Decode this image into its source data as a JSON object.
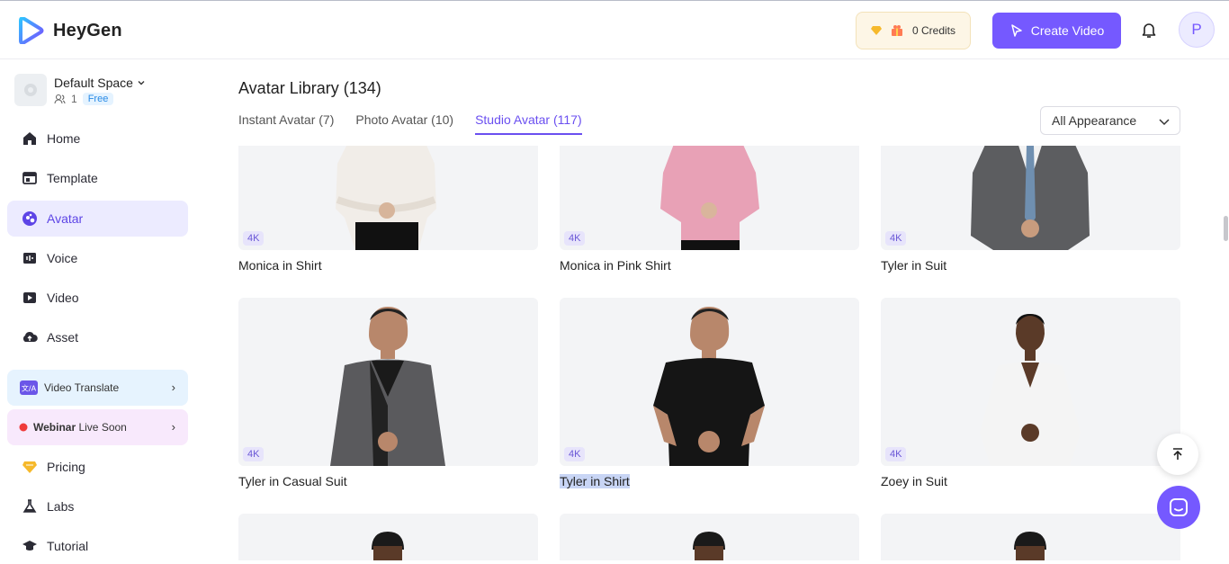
{
  "app": {
    "name": "HeyGen"
  },
  "header": {
    "credits_label": "0 Credits",
    "create_label": "Create Video",
    "profile_initial": "P"
  },
  "sidebar": {
    "space_name": "Default Space",
    "member_count": "1",
    "plan_badge": "Free",
    "nav": [
      {
        "label": "Home",
        "icon": "home-icon"
      },
      {
        "label": "Template",
        "icon": "template-icon"
      },
      {
        "label": "Avatar",
        "icon": "avatar-icon"
      },
      {
        "label": "Voice",
        "icon": "voice-icon"
      },
      {
        "label": "Video",
        "icon": "video-icon"
      },
      {
        "label": "Asset",
        "icon": "asset-icon"
      }
    ],
    "promo_translate": "Video Translate",
    "promo_webinar_bold": "Webinar",
    "promo_webinar_rest": "Live Soon",
    "nav2": [
      {
        "label": "Pricing",
        "icon": "pricing-icon"
      },
      {
        "label": "Labs",
        "icon": "labs-icon"
      },
      {
        "label": "Tutorial",
        "icon": "tutorial-icon"
      }
    ]
  },
  "main": {
    "title": "Avatar Library (134)",
    "tabs": [
      {
        "label": "Instant Avatar (7)"
      },
      {
        "label": "Photo Avatar (10)"
      },
      {
        "label": "Studio Avatar (117)"
      }
    ],
    "filter": "All Appearance",
    "badge_4k": "4K",
    "avatars": [
      {
        "name": "Monica in Shirt"
      },
      {
        "name": "Monica in Pink Shirt"
      },
      {
        "name": "Tyler in Suit"
      },
      {
        "name": "Tyler in Casual Suit"
      },
      {
        "name": "Tyler in Shirt"
      },
      {
        "name": "Zoey in Suit"
      }
    ]
  },
  "colors": {
    "accent": "#7559ff",
    "active_bg": "#ecebff"
  }
}
